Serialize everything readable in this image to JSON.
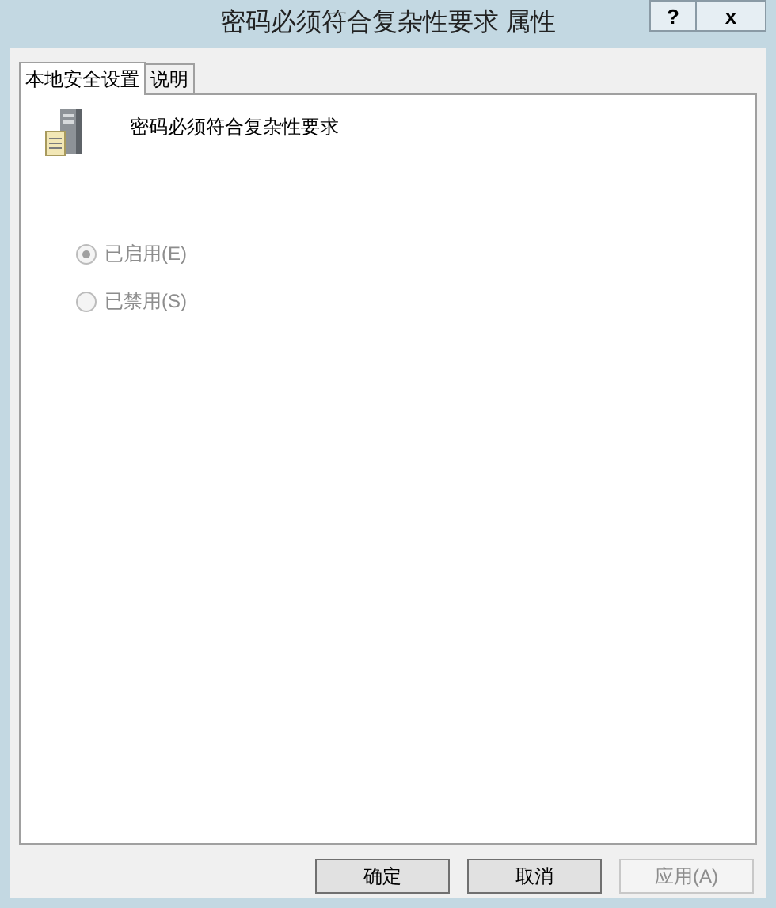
{
  "window": {
    "title": "密码必须符合复杂性要求 属性",
    "help": "?",
    "close": "x"
  },
  "tabs": [
    {
      "label": "本地安全设置",
      "selected": true
    },
    {
      "label": "说明",
      "selected": false
    }
  ],
  "policy": {
    "name": "密码必须符合复杂性要求"
  },
  "options": [
    {
      "label": "已启用(E)",
      "selected": true,
      "disabled": true
    },
    {
      "label": "已禁用(S)",
      "selected": false,
      "disabled": true
    }
  ],
  "buttons": [
    {
      "label": "确定",
      "disabled": false
    },
    {
      "label": "取消",
      "disabled": false
    },
    {
      "label": "应用(A)",
      "disabled": true
    }
  ]
}
